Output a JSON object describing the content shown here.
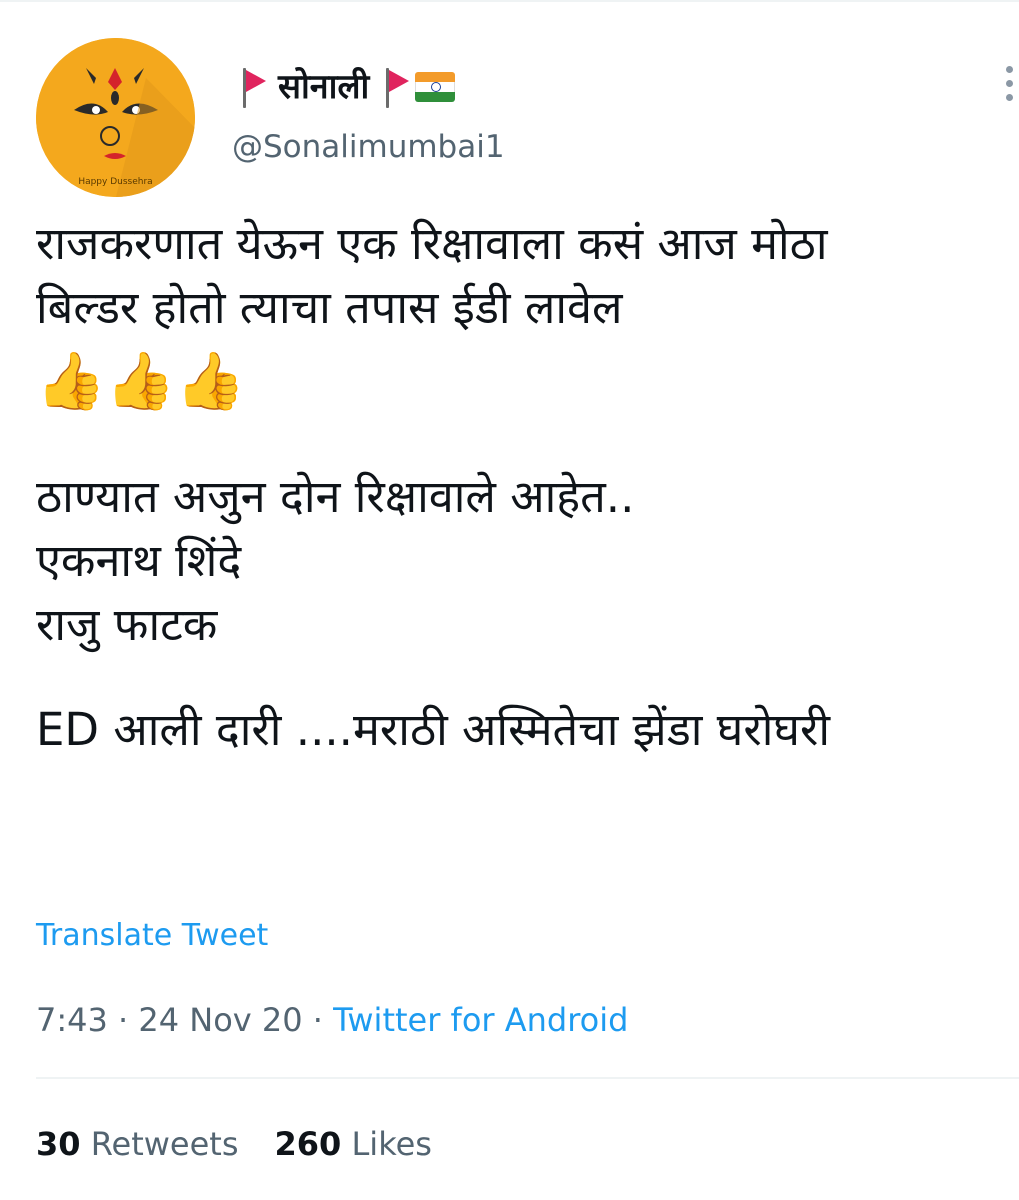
{
  "tweet": {
    "author": {
      "display_name": "सोनाली",
      "handle": "@Sonalimumbai1",
      "avatar_caption": "Happy Dussehra"
    },
    "body_lines": [
      "राजकरणात येऊन एक रिक्षावाला कसं आज मोठा",
      "बिल्डर होतो त्याचा तपास ईडी लावेल",
      "👍👍👍",
      "ठाण्यात अजुन दोन रिक्षावाले आहेत..",
      "एकनाथ शिंदे",
      "राजु फाटक",
      "ED आली दारी ....मराठी अस्मितेचा झेंडा घरोघरी"
    ],
    "translate_label": "Translate Tweet",
    "time": "7:43",
    "date": "24 Nov 20",
    "separator": "·",
    "source": "Twitter for Android",
    "retweets_count": "30",
    "retweets_label": "Retweets",
    "likes_count": "260",
    "likes_label": "Likes"
  },
  "colors": {
    "accent": "#1d9bf0",
    "secondary_text": "#536471",
    "primary_text": "#0f1419",
    "avatar_bg": "#f4a81d"
  },
  "icons": [
    "red-flag-icon",
    "india-flag-icon",
    "more-options-icon"
  ]
}
